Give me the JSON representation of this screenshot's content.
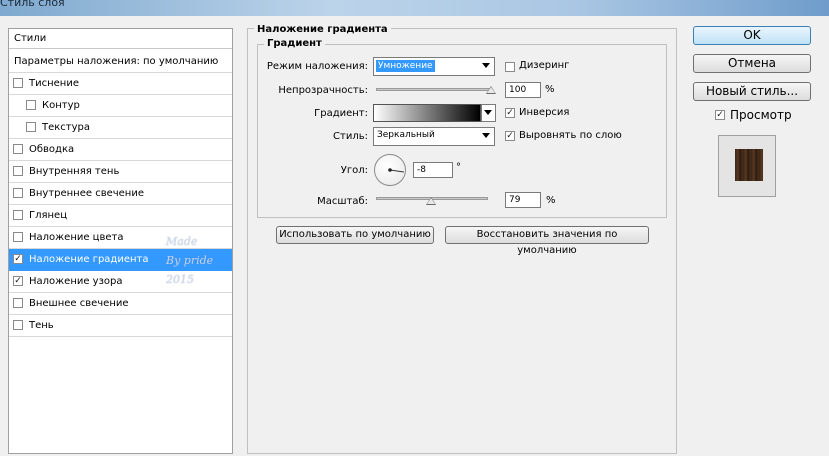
{
  "window": {
    "title": "Стиль слоя"
  },
  "styles_panel": {
    "header": "Стили",
    "defaults_row": "Параметры наложения: по умолчанию",
    "items": [
      {
        "label": "Тиснение",
        "checked": false,
        "indent": false,
        "selected": false
      },
      {
        "label": "Контур",
        "checked": false,
        "indent": true,
        "selected": false
      },
      {
        "label": "Текстура",
        "checked": false,
        "indent": true,
        "selected": false
      },
      {
        "label": "Обводка",
        "checked": false,
        "indent": false,
        "selected": false
      },
      {
        "label": "Внутренняя тень",
        "checked": false,
        "indent": false,
        "selected": false
      },
      {
        "label": "Внутреннее свечение",
        "checked": false,
        "indent": false,
        "selected": false
      },
      {
        "label": "Глянец",
        "checked": false,
        "indent": false,
        "selected": false
      },
      {
        "label": "Наложение цвета",
        "checked": false,
        "indent": false,
        "selected": false
      },
      {
        "label": "Наложение градиента",
        "checked": true,
        "indent": false,
        "selected": true
      },
      {
        "label": "Наложение узора",
        "checked": true,
        "indent": false,
        "selected": false
      },
      {
        "label": "Внешнее свечение",
        "checked": false,
        "indent": false,
        "selected": false
      },
      {
        "label": "Тень",
        "checked": false,
        "indent": false,
        "selected": false
      }
    ],
    "watermark": [
      "Made",
      "By pride",
      "2015"
    ]
  },
  "gradient_overlay": {
    "section_title": "Наложение градиента",
    "group_title": "Градиент",
    "blend_mode_label": "Режим наложения:",
    "blend_mode_value": "Умножение",
    "dither_label": "Дизеринг",
    "dither_checked": false,
    "opacity_label": "Непрозрачность:",
    "opacity_value": "100",
    "opacity_percent": 100,
    "opacity_unit": "%",
    "gradient_label": "Градиент:",
    "reverse_label": "Инверсия",
    "reverse_checked": true,
    "style_label": "Стиль:",
    "style_value": "Зеркальный",
    "align_label": "Выровнять по слою",
    "align_checked": true,
    "angle_label": "Угол:",
    "angle_value": "-8",
    "angle_degrees": -8,
    "angle_unit": "°",
    "scale_label": "Масштаб:",
    "scale_value": "79",
    "scale_percent": 79,
    "scale_unit": "%",
    "make_default_button": "Использовать по умолчанию",
    "reset_default_button": "Восстановить значения по умолчанию"
  },
  "dialog_buttons": {
    "ok": "OK",
    "cancel": "Отмена",
    "new_style": "Новый стиль...",
    "preview_label": "Просмотр",
    "preview_checked": true
  }
}
